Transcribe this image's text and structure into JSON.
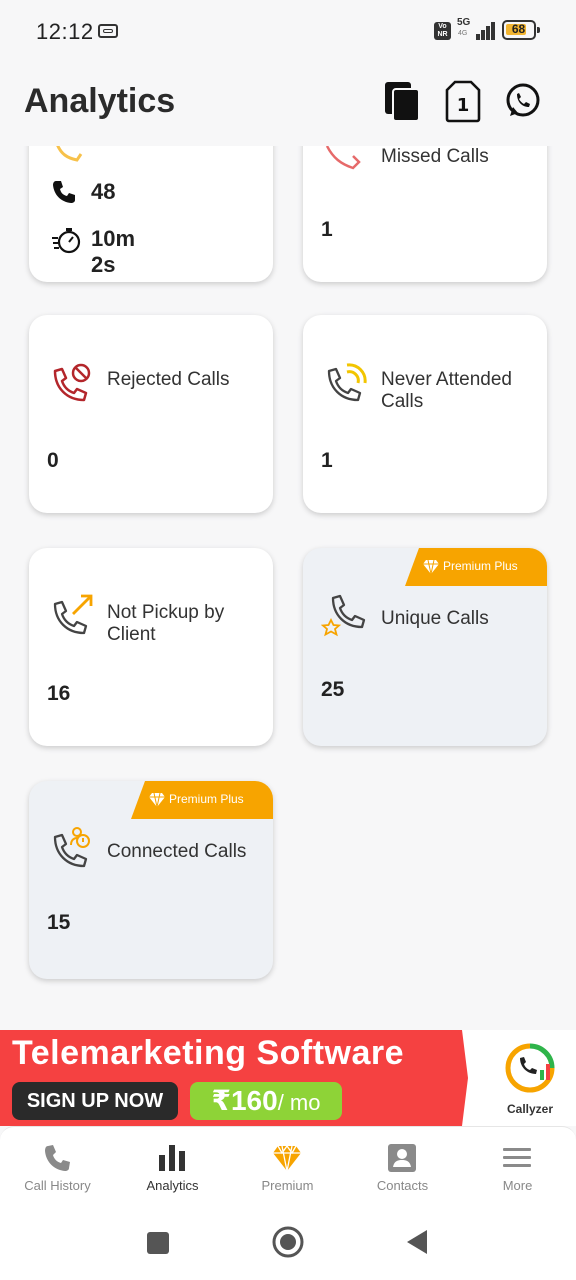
{
  "status_bar": {
    "time": "12:12",
    "network": "5G",
    "network_sub": "4G",
    "vonr": "Vo NR",
    "battery": "68"
  },
  "header": {
    "title": "Analytics",
    "icons": [
      "copy-icon",
      "sim-icon",
      "whatsapp-icon"
    ]
  },
  "top_cards": {
    "left": {
      "calls_count": "48",
      "duration": "10m 2s"
    },
    "right": {
      "title": "Missed Calls",
      "value": "1"
    }
  },
  "cards": [
    {
      "title": "Rejected Calls",
      "value": "0",
      "icon": "rejected-call-icon"
    },
    {
      "title": "Never Attended Calls",
      "value": "1",
      "icon": "never-attended-icon"
    },
    {
      "title": "Not Pickup by Client",
      "value": "16",
      "icon": "outgoing-call-icon"
    },
    {
      "title": "Unique Calls",
      "value": "25",
      "icon": "unique-call-icon",
      "badge": "Premium Plus"
    },
    {
      "title": "Connected Calls",
      "value": "15",
      "icon": "connected-call-icon",
      "badge": "Premium Plus"
    }
  ],
  "ad": {
    "headline": "Telemarketing Software",
    "cta": "SIGN UP NOW",
    "price": "₹160",
    "price_unit": "/ mo",
    "brand": "Callyzer"
  },
  "bottom_nav": [
    {
      "label": "Call History",
      "icon": "phone-icon"
    },
    {
      "label": "Analytics",
      "icon": "bar-chart-icon",
      "active": true
    },
    {
      "label": "Premium",
      "icon": "diamond-icon"
    },
    {
      "label": "Contacts",
      "icon": "contact-card-icon"
    },
    {
      "label": "More",
      "icon": "menu-icon"
    }
  ],
  "colors": {
    "accent_orange": "#f7a400",
    "ad_red": "#f54141",
    "ad_green": "#8ed337",
    "rejected_red": "#b3262b"
  }
}
